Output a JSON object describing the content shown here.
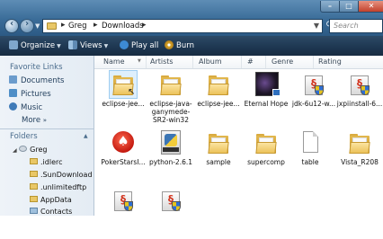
{
  "window": {
    "breadcrumbs": [
      "Greg",
      "Downloads"
    ],
    "search_placeholder": "Search",
    "controls": [
      "minimize",
      "maximize",
      "close"
    ]
  },
  "toolbar": {
    "items": [
      {
        "label": "Organize",
        "icon": "organize-icon",
        "has_menu": true
      },
      {
        "label": "Views",
        "icon": "views-icon",
        "has_menu": true
      },
      {
        "label": "Play all",
        "icon": "play-icon",
        "has_menu": false
      },
      {
        "label": "Burn",
        "icon": "burn-icon",
        "has_menu": false
      }
    ]
  },
  "sidebar": {
    "favorite_links_title": "Favorite Links",
    "favorites": [
      {
        "label": "Documents",
        "icon": "documents-icon"
      },
      {
        "label": "Pictures",
        "icon": "pictures-icon"
      },
      {
        "label": "Music",
        "icon": "music-icon"
      }
    ],
    "more_label": "More",
    "folders_title": "Folders",
    "tree": [
      {
        "label": "Greg",
        "depth": 0
      },
      {
        "label": ".idlerc",
        "depth": 1
      },
      {
        "label": ".SunDownload",
        "depth": 1
      },
      {
        "label": ".unlimitedftp",
        "depth": 1
      },
      {
        "label": "AppData",
        "depth": 1
      },
      {
        "label": "Contacts",
        "depth": 1
      }
    ]
  },
  "columns": [
    "Name",
    "Artists",
    "Album",
    "#",
    "Genre",
    "Rating"
  ],
  "files": [
    {
      "label": "eclipse-jee...",
      "type": "folder",
      "selected": true
    },
    {
      "label": "eclipse-java-ganymede-SR2-win32",
      "type": "folder"
    },
    {
      "label": "eclipse-jee...",
      "type": "folder"
    },
    {
      "label": "Eternal Hope",
      "type": "video"
    },
    {
      "label": "jdk-6u12-w...",
      "type": "installer"
    },
    {
      "label": "jxpiinstall-6...",
      "type": "installer"
    },
    {
      "label": "PokerStarsI...",
      "type": "poker"
    },
    {
      "label": "python-2.6.1",
      "type": "python"
    },
    {
      "label": "sample",
      "type": "folder"
    },
    {
      "label": "supercomp",
      "type": "folder"
    },
    {
      "label": "table",
      "type": "blank"
    },
    {
      "label": "Vista_R208",
      "type": "folder"
    },
    {
      "label": "",
      "type": "installer"
    },
    {
      "label": "",
      "type": "installer"
    }
  ],
  "colors": {
    "titlebar": "#3a6c98",
    "toolbar": "#1d3650",
    "sidebar_text": "#1f3c5a",
    "folder": "#e9c766"
  }
}
